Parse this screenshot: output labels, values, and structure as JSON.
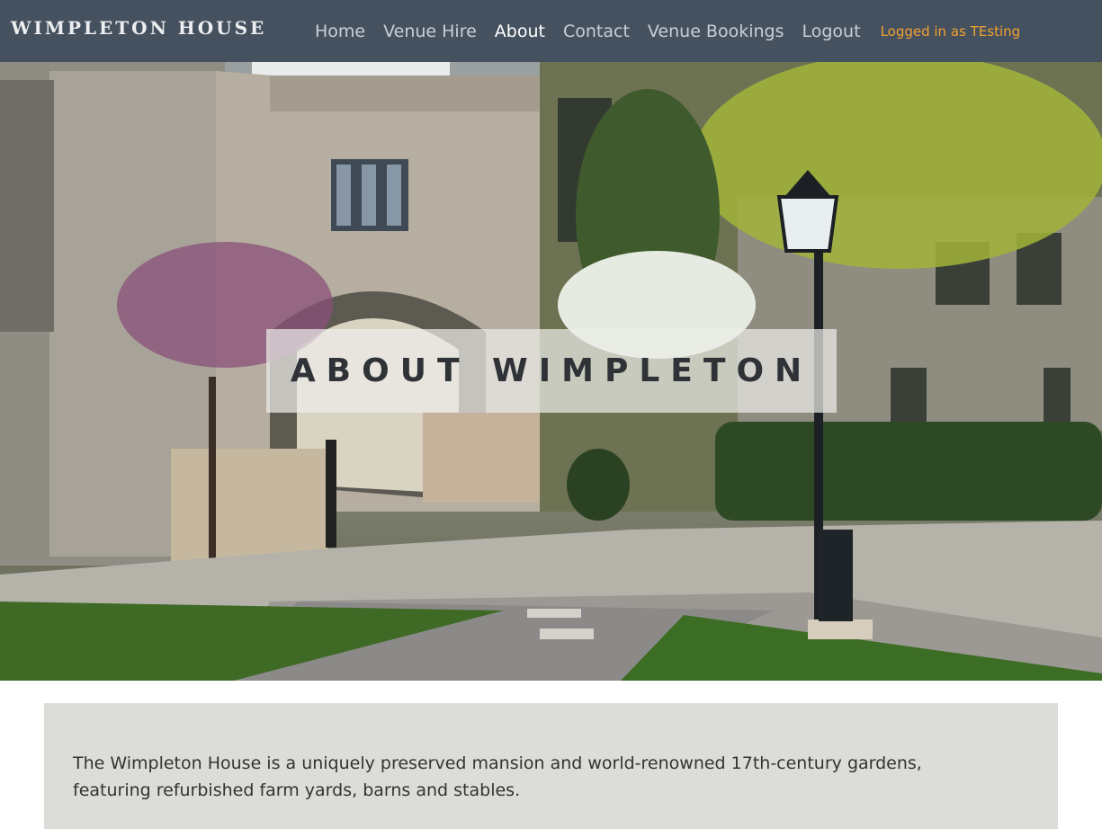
{
  "site": {
    "brand": "WIMPLETON HOUSE"
  },
  "nav": {
    "items": [
      {
        "label": "Home",
        "active": false
      },
      {
        "label": "Venue Hire",
        "active": false
      },
      {
        "label": "About",
        "active": true
      },
      {
        "label": "Contact",
        "active": false
      },
      {
        "label": "Venue Bookings",
        "active": false
      },
      {
        "label": "Logout",
        "active": false
      }
    ],
    "login_status": "Logged in as TEsting",
    "login_status_color": "#f0a030"
  },
  "hero": {
    "title": "ABOUT WIMPLETON",
    "image_description_icon": "hero-photo"
  },
  "intro": {
    "text": "The Wimpleton House is a uniquely preserved mansion and world-renowned 17th-century gardens, featuring refurbished farm yards, barns and stables."
  },
  "colors": {
    "navbar": "#465160",
    "panel": "#dcddd8",
    "nav_active": "#ffffff"
  }
}
